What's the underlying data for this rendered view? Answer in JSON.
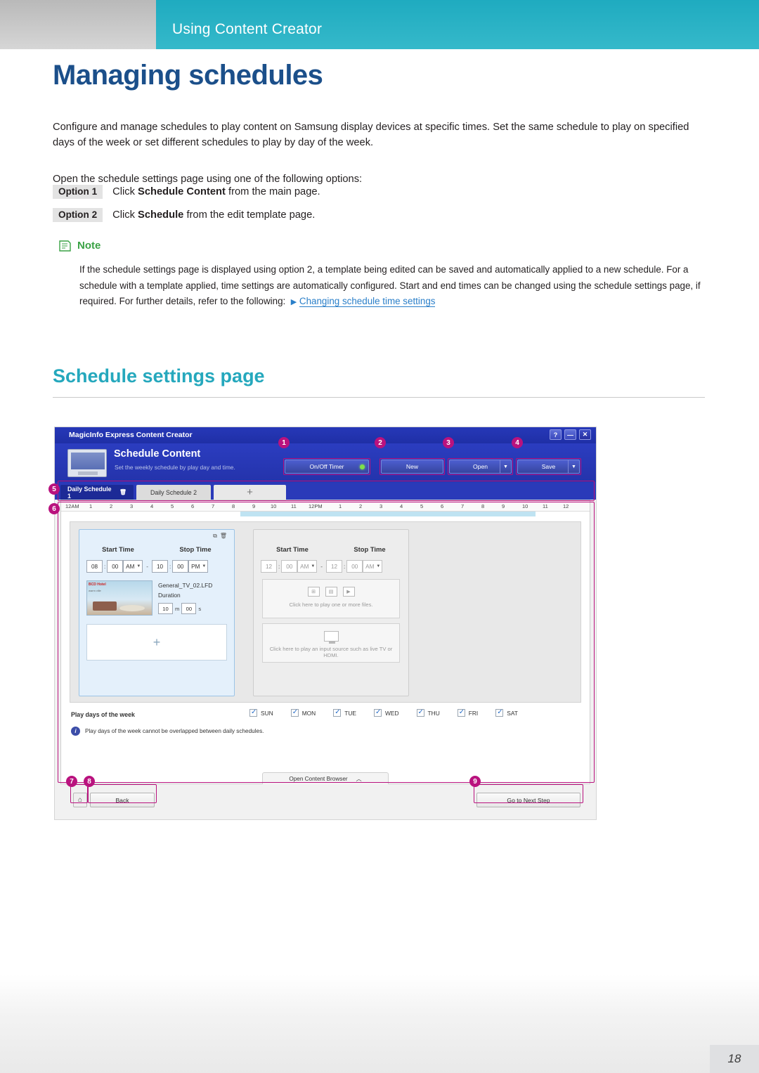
{
  "header": {
    "title": "Using Content Creator"
  },
  "page": {
    "title": "Managing schedules",
    "intro": "Configure and manage schedules to play content on Samsung display devices at specific times. Set the same schedule to play on specified days of the week or set different schedules to play by day of the week.",
    "open_line": "Open the schedule settings page using one of the following options:",
    "options": [
      {
        "tag": "Option 1",
        "pre": "Click ",
        "bold": "Schedule Content",
        "post": " from the main page."
      },
      {
        "tag": "Option 2",
        "pre": "Click ",
        "bold": "Schedule",
        "post": " from the edit template page."
      }
    ],
    "note": {
      "label": "Note",
      "body": "If the schedule settings page is displayed using option 2, a template being edited can be saved and automatically applied to a new schedule. For a schedule with a template applied, time settings are automatically configured. Start and end times can be changed using the schedule settings page, if required. For further details, refer to the following:",
      "link": "Changing schedule time settings"
    },
    "section_title": "Schedule settings page",
    "page_number": "18"
  },
  "app": {
    "window_title": "MagicInfo Express Content Creator",
    "window_buttons": [
      "?",
      "—",
      "✕"
    ],
    "heading": "Schedule Content",
    "subheading": "Set the weekly schedule by play day and time.",
    "toolbar": {
      "on_off_timer": "On/Off Timer",
      "new": "New",
      "open": "Open",
      "save": "Save",
      "caret": "▼"
    },
    "tabs": [
      {
        "label": "Daily Schedule 1",
        "state": "active"
      },
      {
        "label": "Daily Schedule 2",
        "state": "inactive"
      },
      {
        "label": "+",
        "state": "add"
      }
    ],
    "ruler_ticks": [
      "12AM",
      "1",
      "2",
      "3",
      "4",
      "5",
      "6",
      "7",
      "8",
      "9",
      "10",
      "11",
      "12PM",
      "1",
      "2",
      "3",
      "4",
      "5",
      "6",
      "7",
      "8",
      "9",
      "10",
      "11",
      "12"
    ],
    "card_one": {
      "start_label": "Start Time",
      "stop_label": "Stop Time",
      "start_hour": "08",
      "start_min": "00",
      "start_ampm": "AM",
      "stop_hour": "10",
      "stop_min": "00",
      "stop_ampm": "PM",
      "file_name": "General_TV_02.LFD",
      "duration_label": "Duration",
      "duration_min": "10",
      "duration_min_unit": "m",
      "duration_sec": "00",
      "duration_sec_unit": "s",
      "thumb_tag": "BCD Hotel",
      "thumb_tag2": "warm ville",
      "add_glyph": "+"
    },
    "card_two": {
      "start_label": "Start Time",
      "stop_label": "Stop Time",
      "start_hour": "12",
      "start_min": "00",
      "start_ampm": "AM",
      "stop_hour": "12",
      "stop_min": "00",
      "stop_ampm": "AM",
      "drop_files": "Click here to play one or more files.",
      "drop_input": "Click here to play an input source such as live TV or HDMI."
    },
    "play_days_label": "Play days of the week",
    "days": [
      "SUN",
      "MON",
      "TUE",
      "WED",
      "THU",
      "FRI",
      "SAT"
    ],
    "info_text": "Play days of the week cannot be overlapped between daily schedules.",
    "content_browser": "Open Content Browser",
    "content_browser_caret": "︿",
    "footer": {
      "home_icon": "⌂",
      "back": "Back",
      "next": "Go to Next Step"
    },
    "callouts": [
      "1",
      "2",
      "3",
      "4",
      "5",
      "6",
      "7",
      "8",
      "9"
    ]
  }
}
